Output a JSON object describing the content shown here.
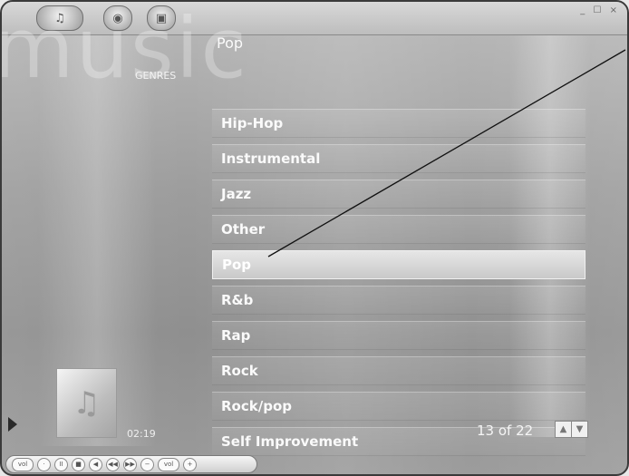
{
  "app": {
    "watermark": "music",
    "section_label": "GENRES",
    "page_title": "Pop",
    "window_controls": "_ ☐ ×"
  },
  "topbar": {
    "main_button_icon": "music-note-icon",
    "buttons": [
      "♫",
      "◉",
      "▣"
    ]
  },
  "list": {
    "items": [
      {
        "label": "Hip-Hop"
      },
      {
        "label": "Instrumental"
      },
      {
        "label": "Jazz"
      },
      {
        "label": "Other"
      },
      {
        "label": "Pop",
        "selected": true
      },
      {
        "label": "R&b"
      },
      {
        "label": "Rap"
      },
      {
        "label": "Rock"
      },
      {
        "label": "Rock/pop"
      },
      {
        "label": "Self Improvement"
      }
    ]
  },
  "pager": {
    "counter": "13 of 22",
    "up": "▲",
    "down": "▼"
  },
  "now_playing": {
    "time": "02:19",
    "thumb_icon": "album-art-icon"
  },
  "transport": {
    "buttons": [
      "vol",
      "·",
      "II",
      "■",
      "◀",
      "◀◀",
      "▶▶",
      "−",
      "vol",
      "+"
    ]
  }
}
